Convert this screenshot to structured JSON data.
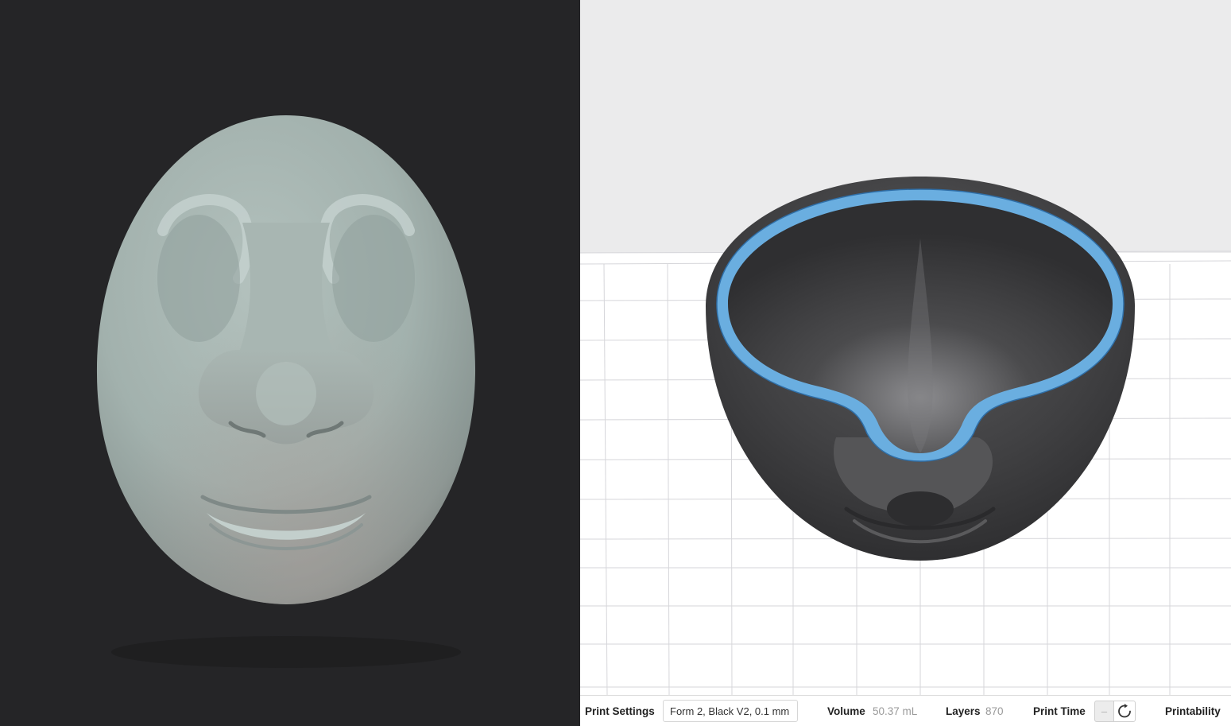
{
  "left_panel": {
    "background": "#252527",
    "render_color": "#a7b6b2"
  },
  "viewport": {
    "background": "#ebebec",
    "grid_color": "#d2d2d6",
    "model_color": "#3a3a3c",
    "cut_color": "#6aaee0"
  },
  "status_bar": {
    "print_settings_label": "Print Settings",
    "print_settings_value": "Form 2, Black V2, 0.1 mm",
    "volume_label": "Volume",
    "volume_value": "50.37 mL",
    "layers_label": "Layers",
    "layers_value": "870",
    "print_time_label": "Print Time",
    "print_time_value": "–",
    "refresh_icon": "refresh-icon",
    "printability_label": "Printability"
  }
}
